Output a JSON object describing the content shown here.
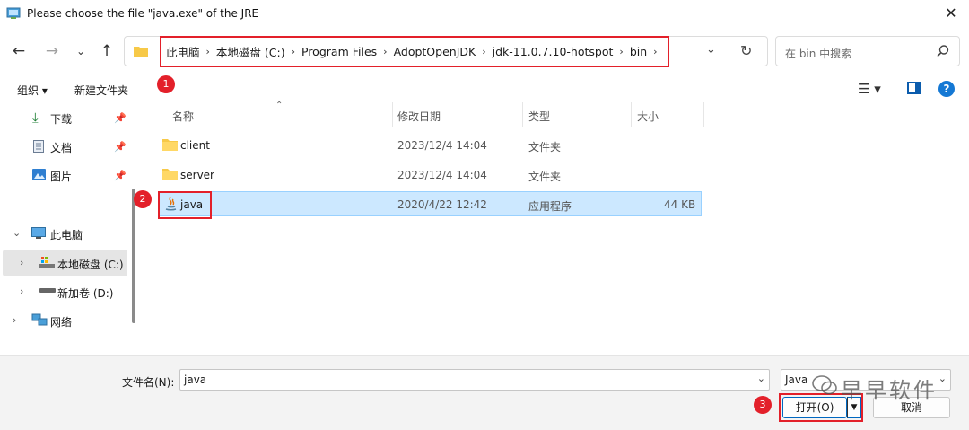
{
  "window": {
    "title": "Please choose the file \"java.exe\" of the JRE"
  },
  "address": {
    "crumbs": [
      "此电脑",
      "本地磁盘 (C:)",
      "Program Files",
      "AdoptOpenJDK",
      "jdk-11.0.7.10-hotspot",
      "bin"
    ]
  },
  "search": {
    "placeholder": "在 bin 中搜索"
  },
  "toolbar": {
    "organize_label": "组织 ▾",
    "new_folder_label": "新建文件夹"
  },
  "sidebar": {
    "quick_access": [
      {
        "label": "下载",
        "icon": "download-icon"
      },
      {
        "label": "文档",
        "icon": "document-icon"
      },
      {
        "label": "图片",
        "icon": "picture-icon"
      }
    ],
    "tree": [
      {
        "label": "此电脑",
        "icon": "computer-icon"
      },
      {
        "label": "本地磁盘 (C:)",
        "icon": "drive-icon"
      },
      {
        "label": "新加卷 (D:)",
        "icon": "drive-icon"
      },
      {
        "label": "网络",
        "icon": "network-icon"
      }
    ]
  },
  "columns": {
    "name": "名称",
    "modified": "修改日期",
    "type": "类型",
    "size": "大小"
  },
  "files": [
    {
      "name": "client",
      "modified": "2023/12/4 14:04",
      "type": "文件夹",
      "size": "",
      "icon": "folder-icon"
    },
    {
      "name": "server",
      "modified": "2023/12/4 14:04",
      "type": "文件夹",
      "size": "",
      "icon": "folder-icon"
    },
    {
      "name": "java",
      "modified": "2020/4/22 12:42",
      "type": "应用程序",
      "size": "44 KB",
      "icon": "java-exe-icon",
      "selected": true
    }
  ],
  "footer": {
    "filename_label": "文件名(N):",
    "filename_value": "java",
    "filetype_value": "Java",
    "open_label": "打开(O)",
    "cancel_label": "取消"
  },
  "annotations": [
    "1",
    "2",
    "3"
  ],
  "watermark": {
    "text": "早早软件"
  },
  "colors": {
    "annotation_red": "#e3202a",
    "selection_bg": "#cce8ff",
    "accent_blue": "#0067c0"
  }
}
